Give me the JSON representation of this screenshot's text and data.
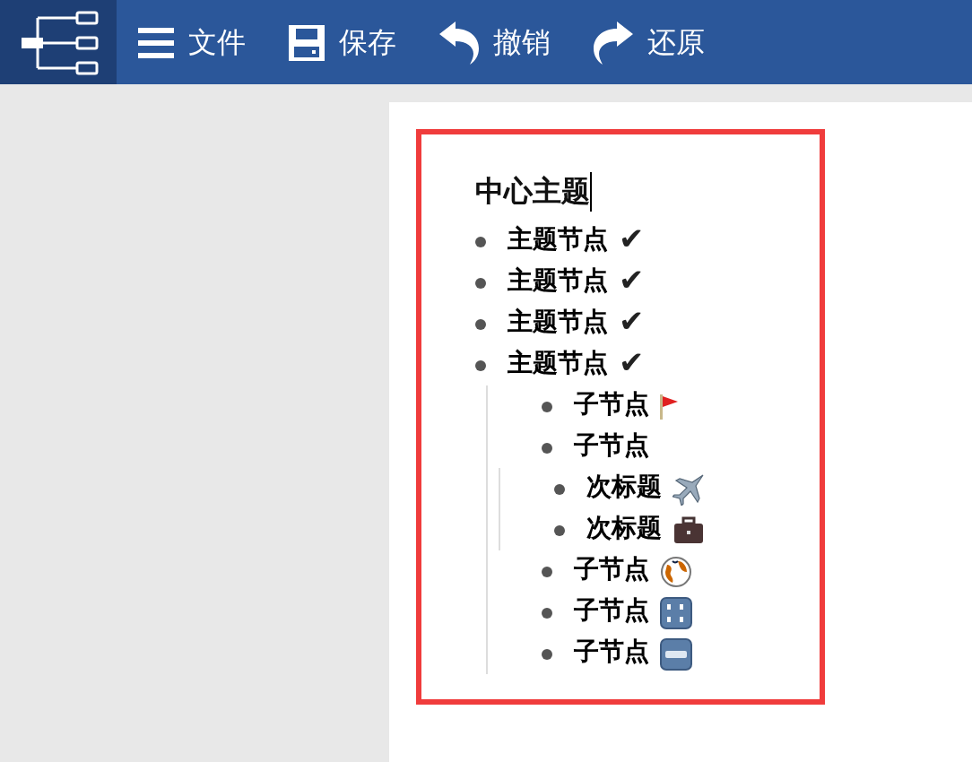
{
  "toolbar": {
    "buttons": [
      {
        "label": "文件"
      },
      {
        "label": "保存"
      },
      {
        "label": "撤销"
      },
      {
        "label": "还原"
      }
    ]
  },
  "outline": {
    "title": "中心主题",
    "items": [
      {
        "text": "主题节点",
        "mark": "✔"
      },
      {
        "text": "主题节点",
        "mark": "✔"
      },
      {
        "text": "主题节点",
        "mark": "✔"
      },
      {
        "text": "主题节点",
        "mark": "✔",
        "children": [
          {
            "text": "子节点",
            "kind": "flag"
          },
          {
            "text": "子节点",
            "children": [
              {
                "text": "次标题",
                "kind": "airplane"
              },
              {
                "text": "次标题",
                "kind": "briefcase"
              }
            ]
          },
          {
            "text": "子节点",
            "kind": "globe"
          },
          {
            "text": "子节点",
            "kind": "numbers"
          },
          {
            "text": "子节点",
            "kind": "letters"
          }
        ]
      }
    ]
  }
}
